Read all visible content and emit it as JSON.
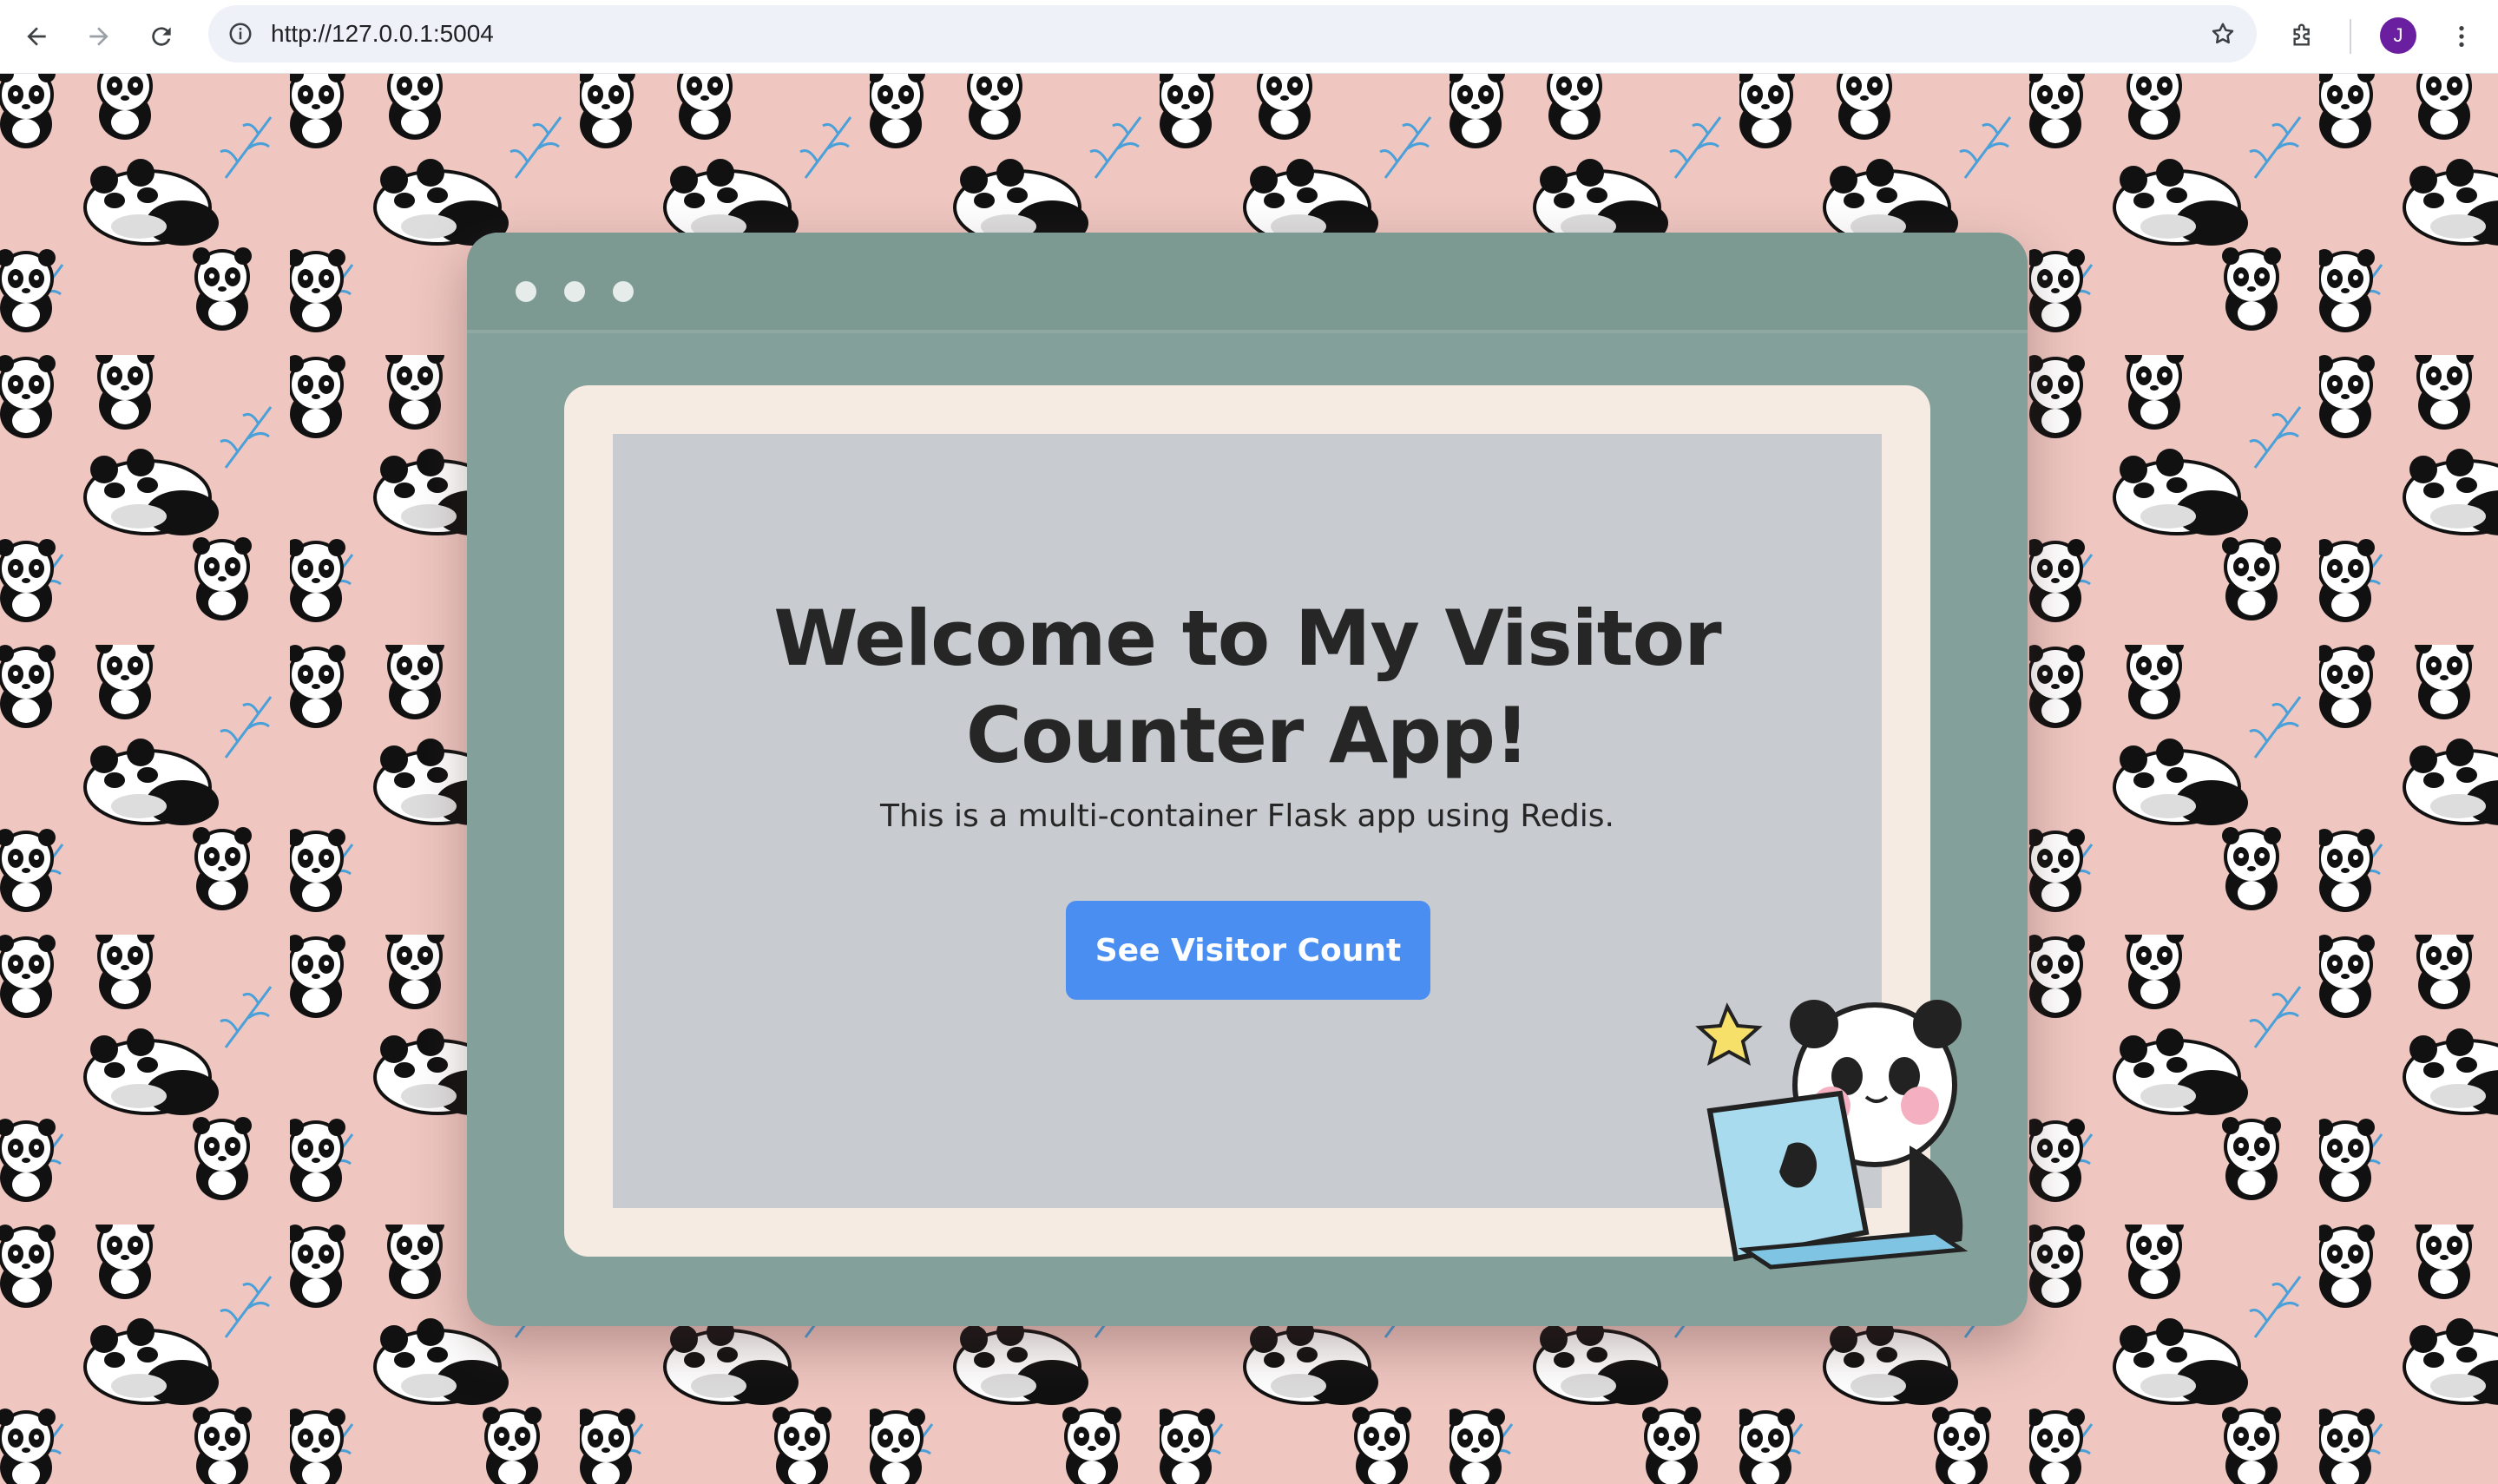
{
  "browser": {
    "url": "http://127.0.0.1:5004",
    "avatar_initial": "J",
    "icons": [
      "back-icon",
      "forward-icon",
      "reload-icon",
      "site-info-icon",
      "bookmark-star-icon",
      "extensions-icon",
      "menu-icon"
    ]
  },
  "page": {
    "title": "Welcome to My Visitor Counter App!",
    "subtitle": "This is a multi-container Flask app using Redis.",
    "button_label": "See Visitor Count"
  },
  "colors": {
    "background": "#efc6c0",
    "card": "#84a09a",
    "frame": "#f6ebe3",
    "panel": "#c8ccd0",
    "button": "#4a8ef1"
  }
}
